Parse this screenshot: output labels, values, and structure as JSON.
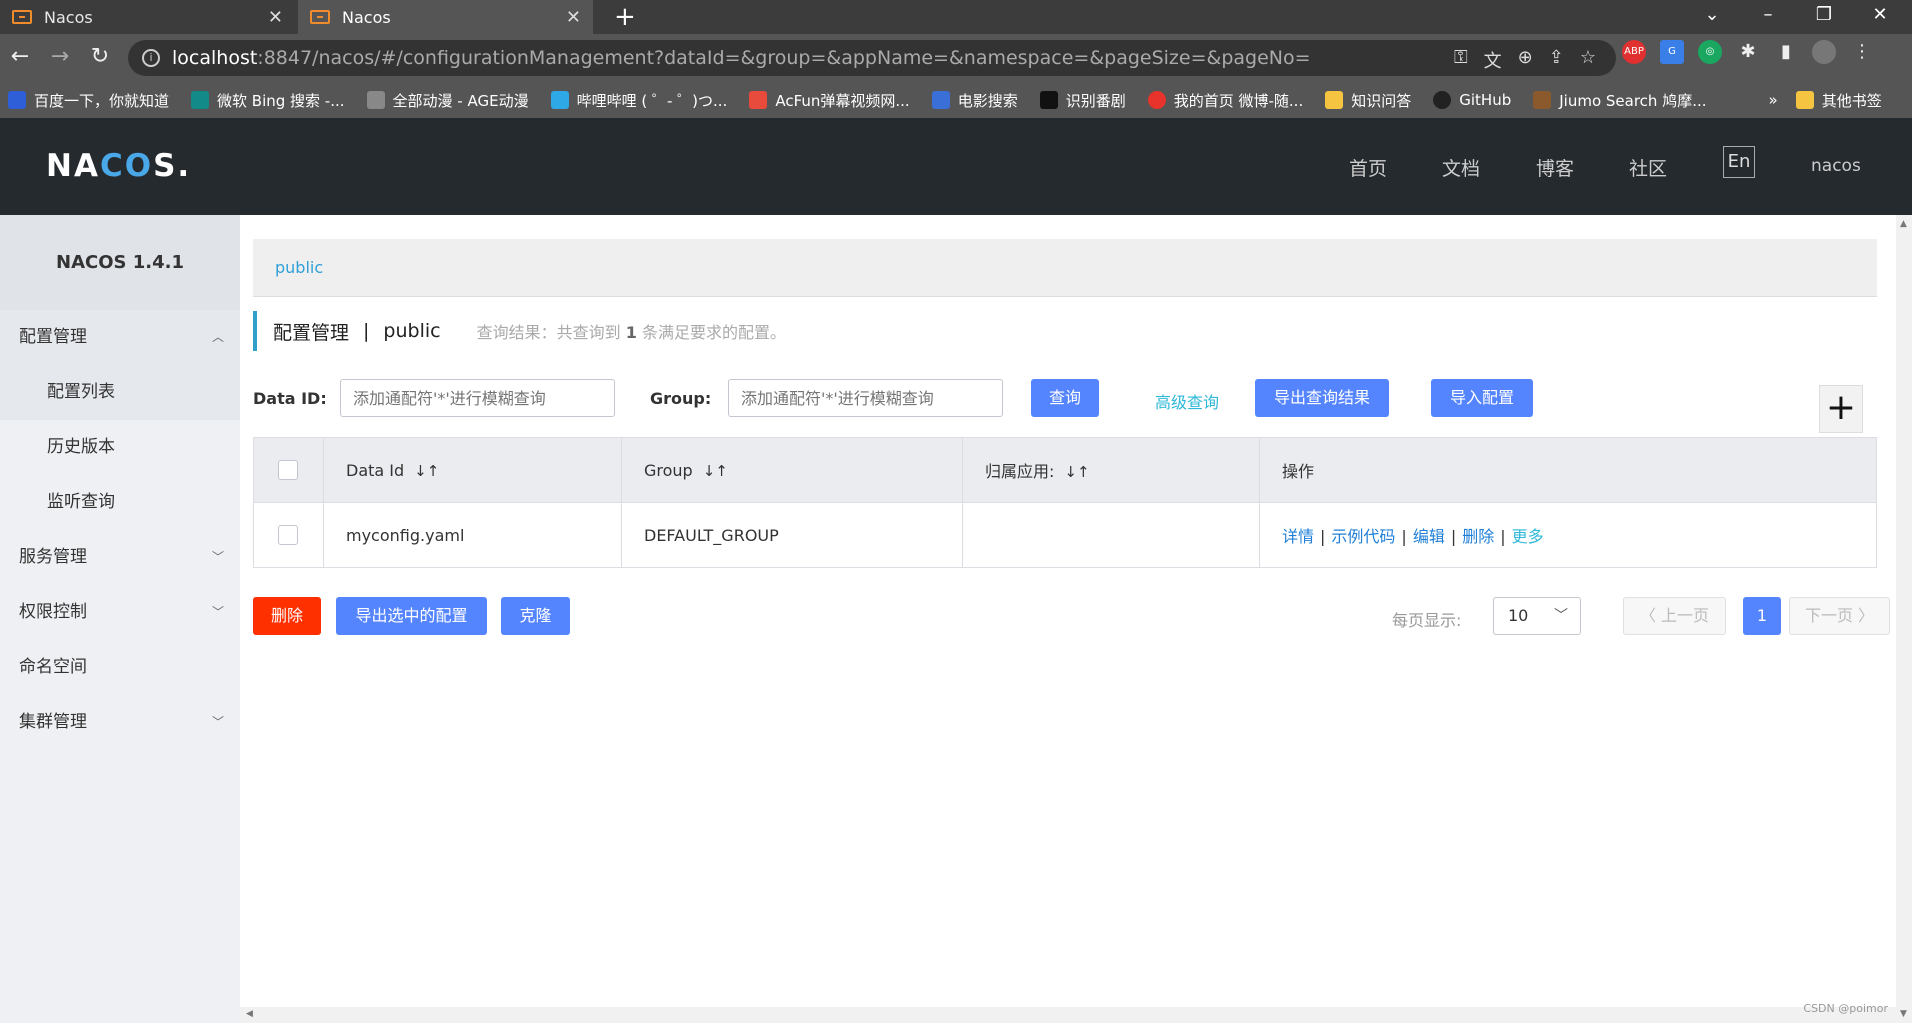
{
  "browser": {
    "tabs": [
      {
        "title": "Nacos",
        "close": "✕"
      },
      {
        "title": "Nacos",
        "close": "✕"
      }
    ],
    "new_tab": "+",
    "url_host": "localhost",
    "url_rest": ":8847/nacos/#/configurationManagement?dataId=&group=&appName=&namespace=&pageSize=&pageNo=",
    "bookmarks": [
      {
        "label": "百度一下，你就知道",
        "color": "#2f5fd8"
      },
      {
        "label": "微软 Bing 搜索 -...",
        "color": "#138a8a"
      },
      {
        "label": "全部动漫 - AGE动漫",
        "color": "#888888"
      },
      {
        "label": "哔哩哔哩 ( ゜- ゜)つ...",
        "color": "#2fa8e8"
      },
      {
        "label": "AcFun弹幕视频网...",
        "color": "#e84b3c"
      },
      {
        "label": "电影搜索",
        "color": "#3a6fd8"
      },
      {
        "label": "识别番剧",
        "color": "#111111"
      },
      {
        "label": "我的首页 微博-随...",
        "color": "#e8322c"
      },
      {
        "label": "知识问答",
        "color": "#f5c542"
      },
      {
        "label": "GitHub",
        "color": "#222222"
      },
      {
        "label": "Jiumo Search 鸠摩...",
        "color": "#8a5a2c"
      }
    ],
    "bookmarks_more": "»",
    "other_bookmarks": "其他书签",
    "extensions": [
      {
        "label": "ABP",
        "color": "#e03030"
      },
      {
        "label": "G",
        "color": "#3a7fe8"
      },
      {
        "label": "◎",
        "color": "#1aa860"
      }
    ]
  },
  "header": {
    "logo_left": "NA",
    "logo_c": "C",
    "logo_o": "O",
    "logo_right": "S.",
    "nav": [
      "首页",
      "文档",
      "博客",
      "社区"
    ],
    "lang": "En",
    "user": "nacos"
  },
  "sidebar": {
    "title": "NACOS 1.4.1",
    "groups": [
      {
        "label": "配置管理",
        "chev": "︿",
        "items": [
          "配置列表",
          "历史版本",
          "监听查询"
        ]
      },
      {
        "label": "服务管理",
        "chev": "﹀"
      },
      {
        "label": "权限控制",
        "chev": "﹀"
      },
      {
        "label": "命名空间"
      },
      {
        "label": "集群管理",
        "chev": "﹀"
      }
    ]
  },
  "main": {
    "namespace_tab": "public",
    "page_title": "配置管理",
    "title_sep": "|",
    "title_ns": "public",
    "result_prefix": "查询结果：共查询到",
    "result_count": "1",
    "result_suffix": "条满足要求的配置。",
    "search": {
      "data_id_label": "Data ID:",
      "data_id_placeholder": "添加通配符'*'进行模糊查询",
      "group_label": "Group:",
      "group_placeholder": "添加通配符'*'进行模糊查询",
      "query_btn": "查询",
      "advanced_link": "高级查询",
      "export_btn": "导出查询结果",
      "import_btn": "导入配置",
      "add_btn": "+"
    },
    "table": {
      "columns": [
        "Data Id",
        "Group",
        "归属应用:",
        "操作"
      ],
      "sort_icon": "↓↑",
      "rows": [
        {
          "data_id": "myconfig.yaml",
          "group": "DEFAULT_GROUP",
          "app": "",
          "ops": [
            "详情",
            "示例代码",
            "编辑",
            "删除"
          ],
          "more": "更多",
          "sep": "|"
        }
      ]
    },
    "bottom": {
      "delete_btn": "删除",
      "export_selected_btn": "导出选中的配置",
      "clone_btn": "克隆",
      "page_size_label": "每页显示:",
      "page_size_value": "10",
      "prev": "〈 上一页",
      "current_page": "1",
      "next": "下一页 〉"
    }
  },
  "watermark": "CSDN @poimor",
  "colors": {
    "primary": "#5584ff",
    "danger": "#ff3000",
    "header_bg": "#252a2f",
    "link": "#2fb8d8"
  }
}
